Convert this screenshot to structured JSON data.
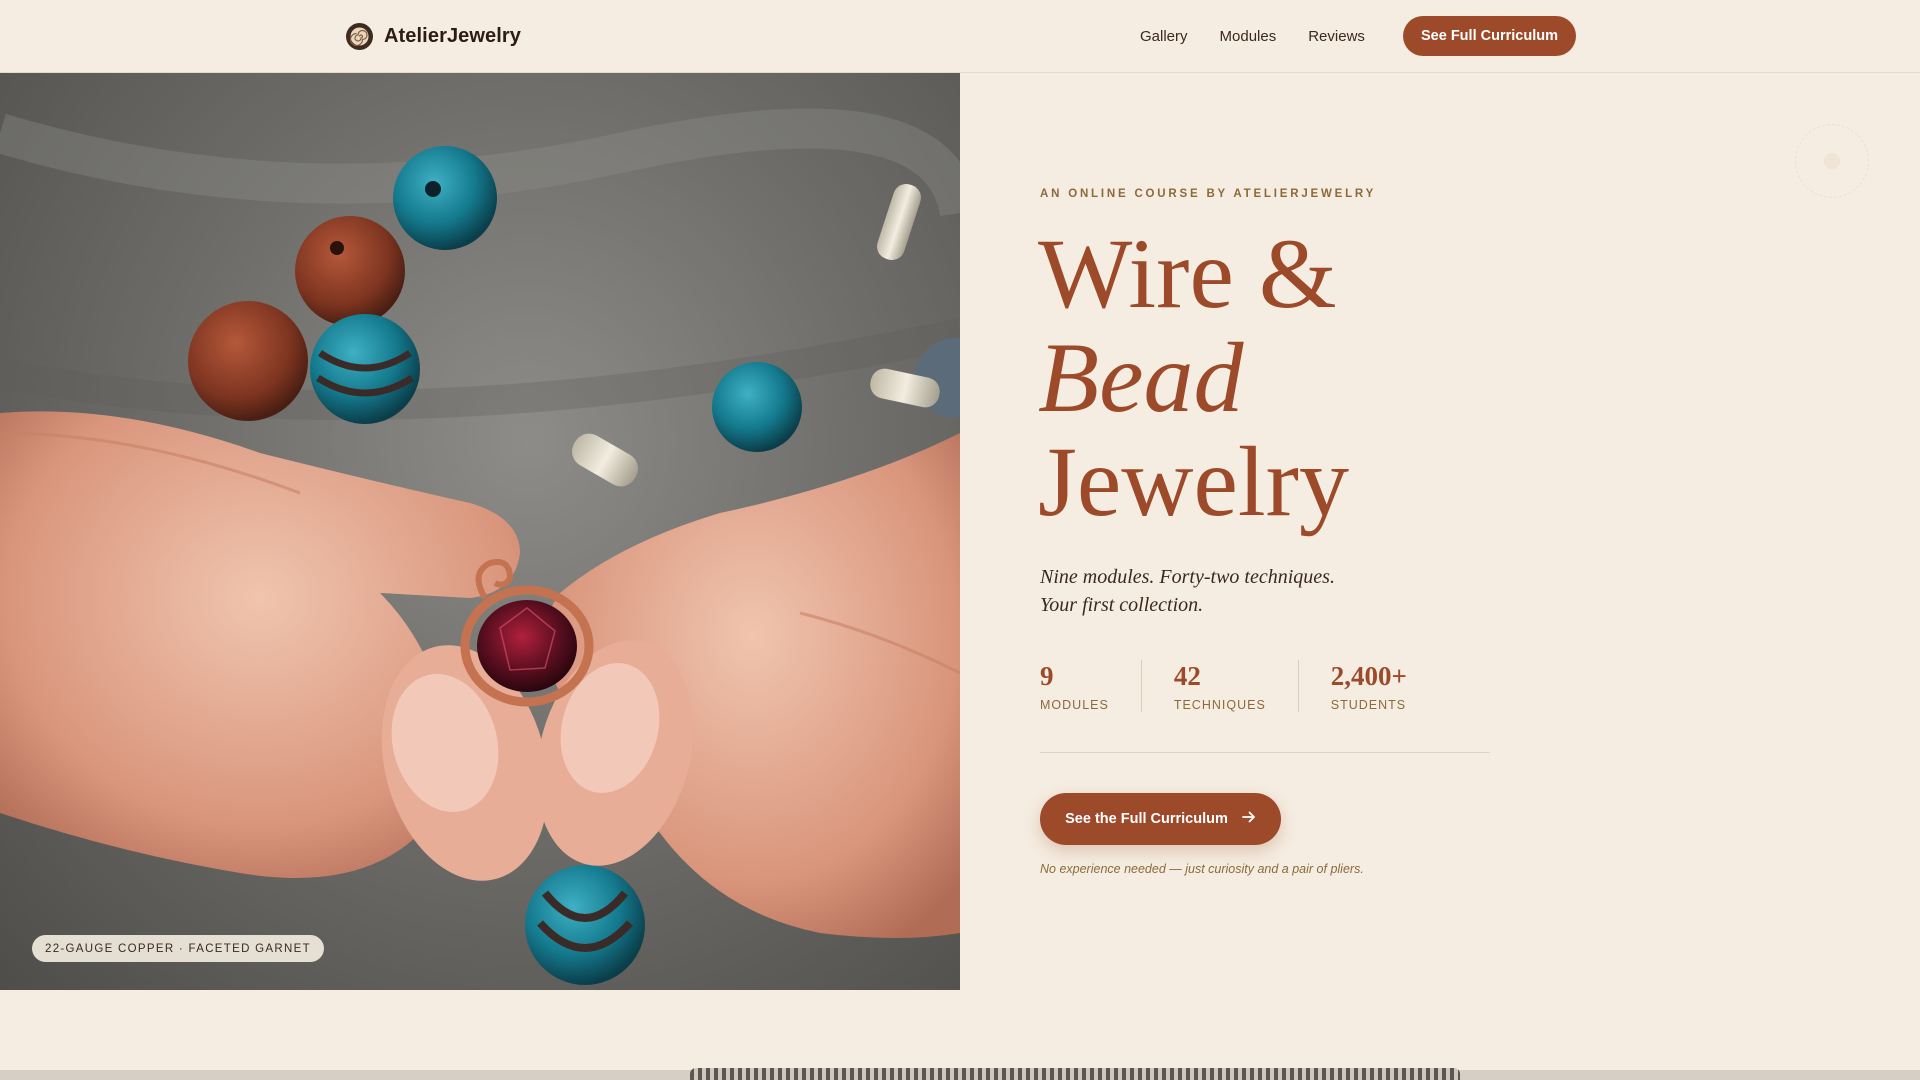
{
  "brand": {
    "name": "AtelierJewelry",
    "logo_icon": "spiral-icon"
  },
  "nav": {
    "links": [
      "Gallery",
      "Modules",
      "Reviews"
    ],
    "cta_label": "See Full Curriculum"
  },
  "hero_image": {
    "caption": "22-GAUGE COPPER · FACETED GARNET"
  },
  "hero": {
    "eyebrow": "AN ONLINE COURSE BY ATELIERJEWELRY",
    "title_line1": "Wire &",
    "title_line2": "Bead",
    "title_line3": "Jewelry",
    "subtitle_line1": "Nine modules. Forty-two techniques.",
    "subtitle_line2": "Your first collection.",
    "stats": [
      {
        "value": "9",
        "label": "MODULES"
      },
      {
        "value": "42",
        "label": "TECHNIQUES"
      },
      {
        "value": "2,400+",
        "label": "STUDENTS"
      }
    ],
    "cta_label": "See the Full Curriculum",
    "cta_icon": "arrow-right-icon",
    "note": "No experience needed — just curiosity and a pair of pliers."
  },
  "colors": {
    "background": "#f5ede1",
    "accent": "#9c4a2a",
    "muted_gold": "#8d6a3a"
  }
}
